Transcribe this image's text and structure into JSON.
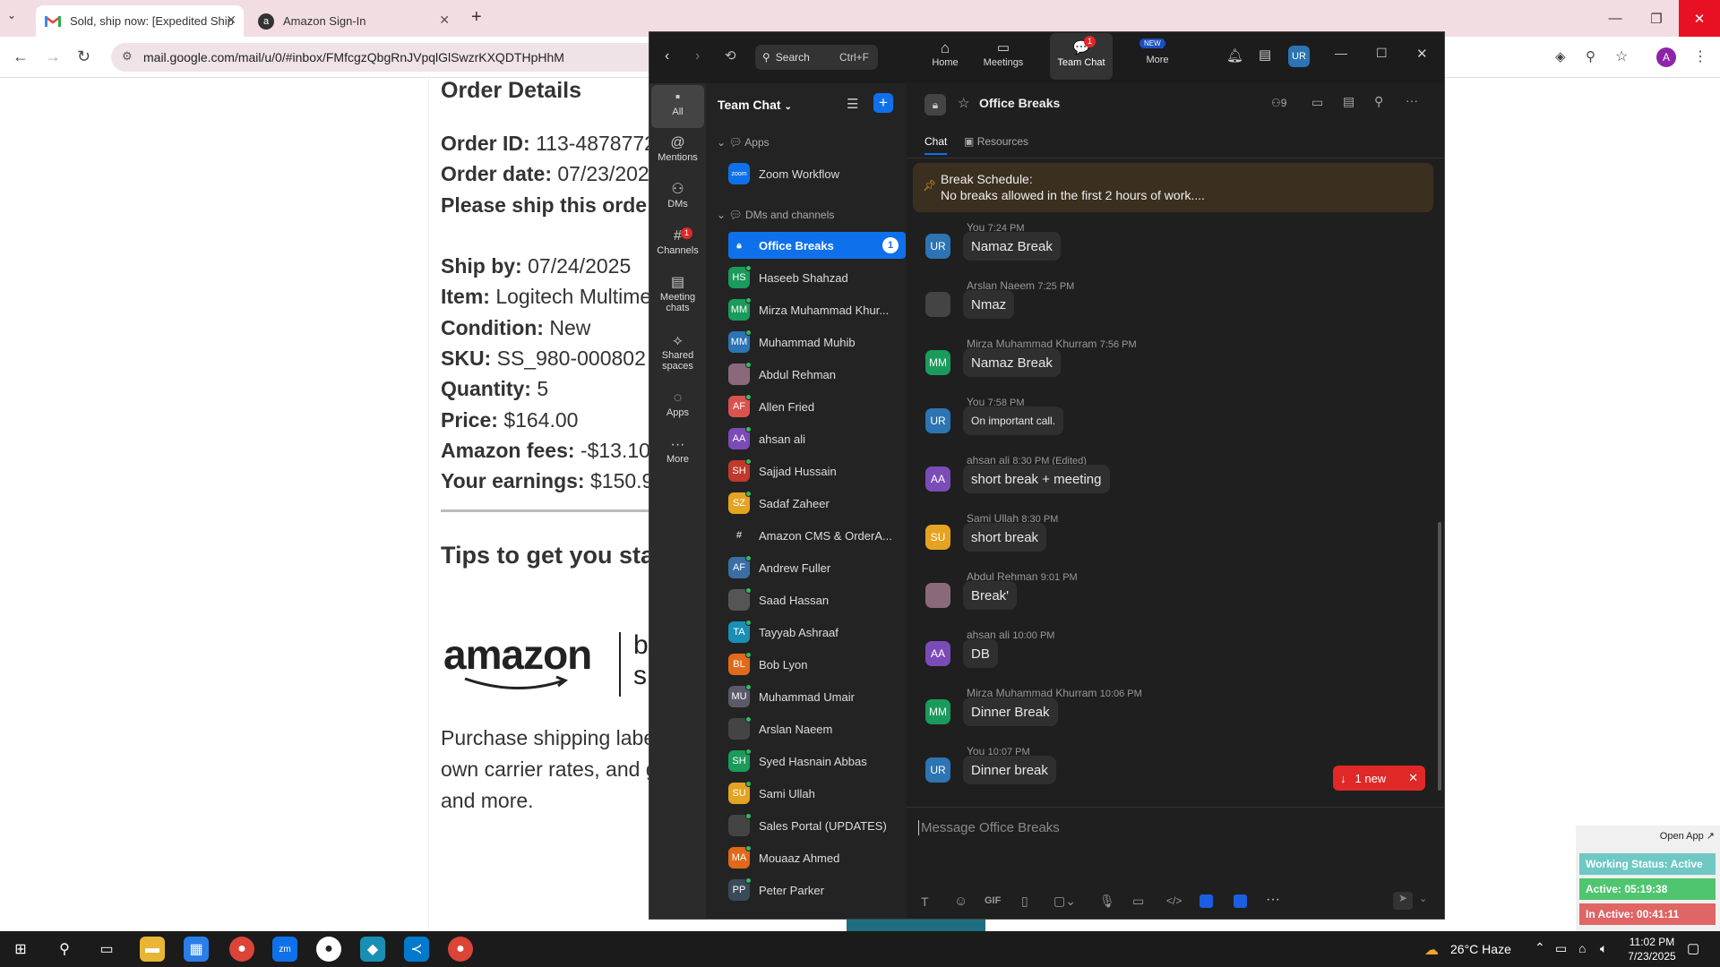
{
  "browser": {
    "tabs": [
      {
        "title": "Sold, ship now: [Expedited Ship"
      },
      {
        "title": "Amazon Sign-In"
      }
    ],
    "url": "mail.google.com/mail/u/0/#inbox/FMfcgzQbgRnJVpqlGlSwzrKXQDTHpHhM",
    "profile_initial": "A"
  },
  "email": {
    "heading": "Order Details",
    "lines": [
      {
        "label": "Order ID:",
        "value": " 113-4878772"
      },
      {
        "label": "Order date:",
        "value": " 07/23/202"
      },
      {
        "label": "Please ship this orde",
        "value": ""
      },
      {
        "label": "Ship by:",
        "value": " 07/24/2025"
      },
      {
        "label": "Item:",
        "value": " Logitech Multime"
      },
      {
        "label": "Condition:",
        "value": " New"
      },
      {
        "label": "SKU:",
        "value": " SS_980-000802"
      },
      {
        "label": "Quantity:",
        "value": " 5"
      },
      {
        "label": "Price:",
        "value": " $164.00"
      },
      {
        "label": "Amazon fees:",
        "value": " -$13.10"
      },
      {
        "label": "Your earnings:",
        "value": " $150.9"
      }
    ],
    "tips": "Tips to get you sta",
    "logo_text": "amazon",
    "logo_side": "b",
    "logo_side2": "s",
    "para": [
      "Purchase shipping labe",
      "own carrier rates, and g",
      "and more."
    ]
  },
  "zoom": {
    "search_label": "Search",
    "search_shortcut": "Ctrl+F",
    "nav": [
      {
        "label": "Home"
      },
      {
        "label": "Meetings"
      },
      {
        "label": "Team Chat",
        "badge": "1"
      },
      {
        "label": "More",
        "badge": "NEW"
      }
    ],
    "user_initials": "UR",
    "rail": [
      {
        "label": "All"
      },
      {
        "label": "Mentions"
      },
      {
        "label": "DMs"
      },
      {
        "label": "Channels",
        "badge": "1"
      },
      {
        "label": "Meeting chats"
      },
      {
        "label": "Shared spaces"
      },
      {
        "label": "Apps"
      },
      {
        "label": "More"
      }
    ],
    "sidebar_title": "Team Chat",
    "sections": {
      "apps": "Apps",
      "dms": "DMs and channels"
    },
    "apps_item": "Zoom Workflow",
    "channels": [
      {
        "name": "Office Breaks",
        "initials": "",
        "color": "#0e71eb",
        "badge": "1"
      },
      {
        "name": "Haseeb Shahzad",
        "initials": "HS",
        "color": "#1a9b5b"
      },
      {
        "name": "Mirza Muhammad Khur...",
        "initials": "MM",
        "color": "#1a9b5b"
      },
      {
        "name": "Muhammad Muhib",
        "initials": "MM",
        "color": "#2c74b3"
      },
      {
        "name": "Abdul Rehman",
        "initials": "",
        "color": "#8a6a7a"
      },
      {
        "name": "Allen Fried",
        "initials": "AF",
        "color": "#d9534f"
      },
      {
        "name": "ahsan ali",
        "initials": "AA",
        "color": "#7b4bb8"
      },
      {
        "name": "Sajjad Hussain",
        "initials": "SH",
        "color": "#c0392b"
      },
      {
        "name": "Sadaf Zaheer",
        "initials": "SZ",
        "color": "#e5a322"
      },
      {
        "name": "Amazon CMS & OrderA...",
        "initials": "#",
        "color": "#232323"
      },
      {
        "name": "Andrew Fuller",
        "initials": "AF",
        "color": "#3a6ea5"
      },
      {
        "name": "Saad Hassan",
        "initials": "",
        "color": "#555"
      },
      {
        "name": "Tayyab Ashraaf",
        "initials": "TA",
        "color": "#1a8fb5"
      },
      {
        "name": "Bob Lyon",
        "initials": "BL",
        "color": "#e06a1a"
      },
      {
        "name": "Muhammad Umair",
        "initials": "MU",
        "color": "#5a5a6a"
      },
      {
        "name": "Arslan Naeem",
        "initials": "",
        "color": "#444"
      },
      {
        "name": "Syed Hasnain Abbas",
        "initials": "SH",
        "color": "#1a9b5b"
      },
      {
        "name": "Sami Ullah",
        "initials": "SU",
        "color": "#e5a322"
      },
      {
        "name": "Sales Portal (UPDATES)",
        "initials": "",
        "color": "#444"
      },
      {
        "name": "Mouaaz Ahmed",
        "initials": "MA",
        "color": "#e06a1a"
      },
      {
        "name": "Peter Parker",
        "initials": "PP",
        "color": "#3a4a5a"
      }
    ],
    "channel_title": "Office Breaks",
    "member_count": "9",
    "tabs": [
      {
        "label": "Chat"
      },
      {
        "label": "Resources"
      }
    ],
    "pinned": {
      "title": "Break Schedule:",
      "body": "No breaks allowed in the first 2 hours of work...."
    },
    "messages": [
      {
        "sender": "You",
        "time": "7:24 PM",
        "text": "Namaz Break",
        "initials": "UR",
        "color": "#2c74b3"
      },
      {
        "sender": "Arslan Naeem",
        "time": "7:25 PM",
        "text": "Nmaz",
        "initials": "",
        "color": "#444"
      },
      {
        "sender": "Mirza Muhammad Khurram",
        "time": "7:56 PM",
        "text": "Namaz Break",
        "initials": "MM",
        "color": "#1a9b5b"
      },
      {
        "sender": "You",
        "time": "7:58 PM",
        "text": "On important call.",
        "initials": "UR",
        "color": "#2c74b3"
      },
      {
        "sender": "ahsan ali",
        "time": "8:30 PM (Edited)",
        "text": "short break + meeting",
        "initials": "AA",
        "color": "#7b4bb8"
      },
      {
        "sender": "Sami Ullah",
        "time": "8:30 PM",
        "text": "short break",
        "initials": "SU",
        "color": "#e5a322"
      },
      {
        "sender": "Abdul Rehman",
        "time": "9:01 PM",
        "text": "Break'",
        "initials": "",
        "color": "#8a6a7a"
      },
      {
        "sender": "ahsan ali",
        "time": "10:00 PM",
        "text": "DB",
        "initials": "AA",
        "color": "#7b4bb8"
      },
      {
        "sender": "Mirza Muhammad Khurram",
        "time": "10:06 PM",
        "text": "Dinner Break",
        "initials": "MM",
        "color": "#1a9b5b"
      },
      {
        "sender": "You",
        "time": "10:07 PM",
        "text": "Dinner break",
        "initials": "UR",
        "color": "#2c74b3"
      }
    ],
    "new_badge": "1 new",
    "composer_placeholder": "Message Office Breaks",
    "gif_label": "GIF"
  },
  "status_widget": {
    "open_app": "Open App ↗",
    "working": "Working Status: Active",
    "active": "Active: 05:19:38",
    "inactive": "In Active: 00:41:11"
  },
  "taskbar": {
    "weather": "26°C  Haze",
    "time": "11:02 PM",
    "date": "7/23/2025"
  }
}
